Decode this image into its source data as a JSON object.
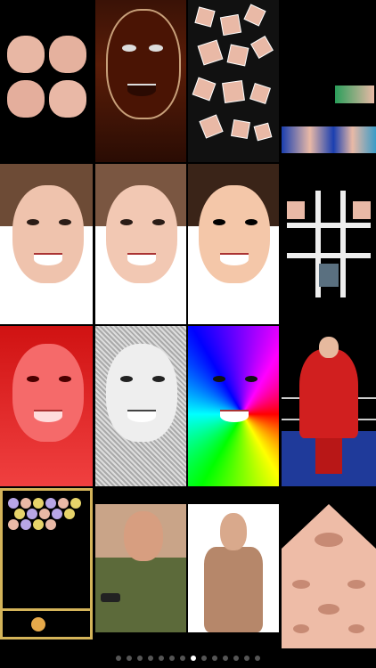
{
  "app": {
    "screen": "effects-gallery"
  },
  "gallery": {
    "rows": [
      [
        "split-faces",
        "dark-negative",
        "scatter-squares",
        "black-bluefaces"
      ],
      [
        "slice-shift",
        "paint-portrait",
        "posterize-portrait",
        "tic-tac-toe"
      ],
      [
        "red-tint",
        "sketch-bw",
        "rainbow-swirl",
        "wrestler-cape"
      ],
      [
        "bubble-game",
        "couch-gamer",
        "muscle-man",
        "kaleido-faces"
      ]
    ]
  },
  "pager": {
    "pages": 14,
    "active_index": 7
  },
  "colors": {
    "background": "#000000",
    "dot_inactive": "#555555",
    "dot_active": "#ffffff",
    "wrestler_red": "#d11f1f",
    "ring_blue": "#1f3a9a"
  }
}
